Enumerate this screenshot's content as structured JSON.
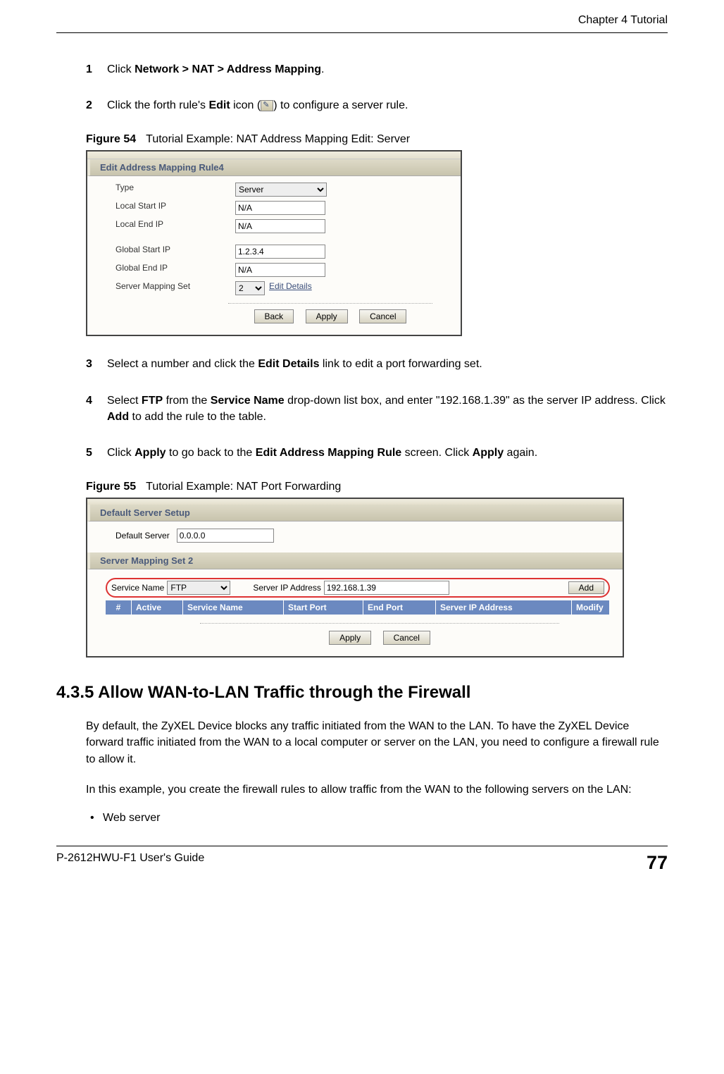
{
  "header": {
    "chapter": "Chapter 4 Tutorial"
  },
  "steps": {
    "s1num": "1",
    "s1a": "Click ",
    "s1b": "Network > NAT > Address Mapping",
    "s1c": ".",
    "s2num": "2",
    "s2a": "Click the forth rule's ",
    "s2b": "Edit",
    "s2c": " icon (",
    "s2d": ") to configure a server rule.",
    "s3num": "3",
    "s3a": "Select a number and click the ",
    "s3b": "Edit Details",
    "s3c": " link to edit a port forwarding set.",
    "s4num": "4",
    "s4a": "Select ",
    "s4b": "FTP",
    "s4c": " from the ",
    "s4d": "Service Name",
    "s4e": " drop-down list box, and enter \"192.168.1.39\" as the server IP address. Click ",
    "s4f": "Add",
    "s4g": " to add the rule to the table.",
    "s5num": "5",
    "s5a": "Click ",
    "s5b": "Apply",
    "s5c": " to go back to the ",
    "s5d": "Edit Address Mapping Rule",
    "s5e": " screen. Click ",
    "s5f": "Apply",
    "s5g": " again."
  },
  "fig54": {
    "cap_label": "Figure 54",
    "cap_text": "Tutorial Example: NAT Address Mapping Edit: Server",
    "hdr": "Edit Address Mapping Rule4",
    "type_label": "Type",
    "type_value": "Server",
    "lsip_label": "Local Start IP",
    "lsip_value": "N/A",
    "leip_label": "Local End IP",
    "leip_value": "N/A",
    "gsip_label": "Global Start IP",
    "gsip_value": "1.2.3.4",
    "geip_label": "Global End IP",
    "geip_value": "N/A",
    "sms_label": "Server Mapping Set",
    "sms_value": "2",
    "edit_details": "Edit Details",
    "btn_back": "Back",
    "btn_apply": "Apply",
    "btn_cancel": "Cancel"
  },
  "fig55": {
    "cap_label": "Figure 55",
    "cap_text": "Tutorial Example: NAT Port Forwarding",
    "hdr1": "Default Server Setup",
    "ds_label": "Default Server",
    "ds_value": "0.0.0.0",
    "hdr2": "Server Mapping Set 2",
    "svc_label": "Service Name",
    "svc_value": "FTP",
    "sip_label": "Server IP Address",
    "sip_value": "192.168.1.39",
    "btn_add": "Add",
    "th_hash": "#",
    "th_active": "Active",
    "th_svc": "Service Name",
    "th_sp": "Start Port",
    "th_ep": "End Port",
    "th_sip": "Server IP Address",
    "th_mod": "Modify",
    "btn_apply": "Apply",
    "btn_cancel": "Cancel"
  },
  "section": {
    "h2": "4.3.5  Allow WAN-to-LAN Traffic through the Firewall",
    "p1": "By default, the ZyXEL Device blocks any traffic initiated from the WAN to the LAN. To have the ZyXEL Device forward traffic initiated from the WAN to a local computer or server on the LAN, you need to configure a firewall rule to allow it.",
    "p2": "In this example, you create the firewall rules to allow traffic from the WAN to the following servers on the LAN:",
    "b1": "Web server"
  },
  "footer": {
    "left": "P-2612HWU-F1 User's Guide",
    "right": "77"
  }
}
